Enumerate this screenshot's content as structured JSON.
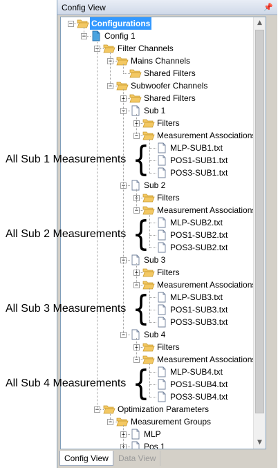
{
  "panel": {
    "title": "Config View",
    "pin_glyph": " ⮟",
    "tabs": [
      "Config View",
      "Data View"
    ]
  },
  "colors": {
    "selection": "#3399ff",
    "folder": "#f3c863",
    "folder_edge": "#c99a2e",
    "doc": "#4aa3df"
  },
  "tree": [
    {
      "label": "Configurations",
      "level": 0,
      "icon": "folder-open-icon",
      "expander": "minus",
      "selected": true
    },
    {
      "label": "Config 1",
      "level": 1,
      "icon": "document-icon",
      "expander": "minus",
      "doc_blue": true
    },
    {
      "label": "Filter Channels",
      "level": 2,
      "icon": "folder-open-icon",
      "expander": "minus"
    },
    {
      "label": "Mains Channels",
      "level": 3,
      "icon": "folder-open-icon",
      "expander": "minus"
    },
    {
      "label": "Shared Filters",
      "level": 4,
      "icon": "folder-open-icon",
      "expander": "none"
    },
    {
      "label": "Subwoofer Channels",
      "level": 3,
      "icon": "folder-open-icon",
      "expander": "minus"
    },
    {
      "label": "Shared Filters",
      "level": 4,
      "icon": "folder-open-icon",
      "expander": "plus"
    },
    {
      "label": "Sub 1",
      "level": 4,
      "icon": "document-icon",
      "expander": "minus"
    },
    {
      "label": "Filters",
      "level": 5,
      "icon": "folder-open-icon",
      "expander": "plus"
    },
    {
      "label": "Measurement Associations",
      "level": 5,
      "icon": "folder-open-icon",
      "expander": "minus"
    },
    {
      "label": "MLP-SUB1.txt",
      "level": 6,
      "icon": "document-icon",
      "expander": "none"
    },
    {
      "label": "POS1-SUB1.txt",
      "level": 6,
      "icon": "document-icon",
      "expander": "none"
    },
    {
      "label": "POS3-SUB1.txt",
      "level": 6,
      "icon": "document-icon",
      "expander": "none"
    },
    {
      "label": "Sub 2",
      "level": 4,
      "icon": "document-icon",
      "expander": "minus"
    },
    {
      "label": "Filters",
      "level": 5,
      "icon": "folder-open-icon",
      "expander": "plus"
    },
    {
      "label": "Measurement Associations",
      "level": 5,
      "icon": "folder-open-icon",
      "expander": "minus"
    },
    {
      "label": "MLP-SUB2.txt",
      "level": 6,
      "icon": "document-icon",
      "expander": "none"
    },
    {
      "label": "POS1-SUB2.txt",
      "level": 6,
      "icon": "document-icon",
      "expander": "none"
    },
    {
      "label": "POS3-SUB2.txt",
      "level": 6,
      "icon": "document-icon",
      "expander": "none"
    },
    {
      "label": "Sub 3",
      "level": 4,
      "icon": "document-icon",
      "expander": "minus"
    },
    {
      "label": "Filters",
      "level": 5,
      "icon": "folder-open-icon",
      "expander": "plus"
    },
    {
      "label": "Measurement Associations",
      "level": 5,
      "icon": "folder-open-icon",
      "expander": "minus"
    },
    {
      "label": "MLP-SUB3.txt",
      "level": 6,
      "icon": "document-icon",
      "expander": "none"
    },
    {
      "label": "POS1-SUB3.txt",
      "level": 6,
      "icon": "document-icon",
      "expander": "none"
    },
    {
      "label": "POS3-SUB3.txt",
      "level": 6,
      "icon": "document-icon",
      "expander": "none"
    },
    {
      "label": "Sub 4",
      "level": 4,
      "icon": "document-icon",
      "expander": "minus"
    },
    {
      "label": "Filters",
      "level": 5,
      "icon": "folder-open-icon",
      "expander": "plus"
    },
    {
      "label": "Measurement Associations",
      "level": 5,
      "icon": "folder-open-icon",
      "expander": "minus"
    },
    {
      "label": "MLP-SUB4.txt",
      "level": 6,
      "icon": "document-icon",
      "expander": "none"
    },
    {
      "label": "POS1-SUB4.txt",
      "level": 6,
      "icon": "document-icon",
      "expander": "none"
    },
    {
      "label": "POS3-SUB4.txt",
      "level": 6,
      "icon": "document-icon",
      "expander": "none"
    },
    {
      "label": "Optimization Parameters",
      "level": 2,
      "icon": "folder-open-icon",
      "expander": "minus"
    },
    {
      "label": "Measurement Groups",
      "level": 3,
      "icon": "folder-open-icon",
      "expander": "minus"
    },
    {
      "label": "MLP",
      "level": 4,
      "icon": "document-icon",
      "expander": "plus"
    },
    {
      "label": "Pos 1",
      "level": 4,
      "icon": "document-icon",
      "expander": "plus"
    }
  ],
  "annotations": [
    "All Sub 1 Measurements",
    "All Sub 2 Measurements",
    "All Sub 3 Measurements",
    "All Sub 4 Measurements"
  ]
}
